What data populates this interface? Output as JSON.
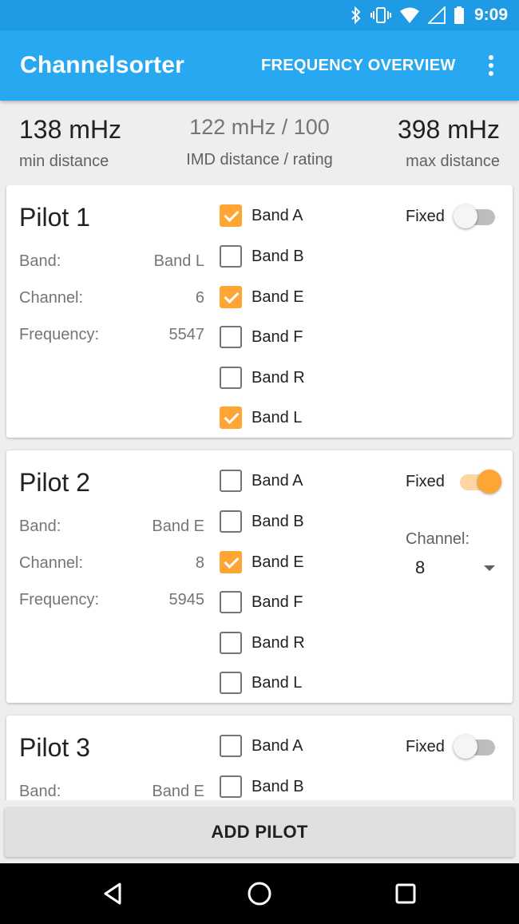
{
  "status_bar": {
    "time": "9:09"
  },
  "app_bar": {
    "title": "Channelsorter",
    "action": "FREQUENCY OVERVIEW"
  },
  "summary": {
    "min": {
      "value": "138 mHz",
      "label": "min distance"
    },
    "imd": {
      "value": "122 mHz / 100",
      "label": "IMD distance / rating"
    },
    "max": {
      "value": "398 mHz",
      "label": "max distance"
    }
  },
  "labels": {
    "band": "Band:",
    "channel": "Channel:",
    "frequency": "Frequency:",
    "fixed": "Fixed",
    "channel_select": "Channel:"
  },
  "pilots": [
    {
      "title": "Pilot 1",
      "band": "Band L",
      "channel": "6",
      "frequency": "5547",
      "fixed": false,
      "bands": [
        {
          "label": "Band A",
          "checked": true
        },
        {
          "label": "Band B",
          "checked": false
        },
        {
          "label": "Band E",
          "checked": true
        },
        {
          "label": "Band F",
          "checked": false
        },
        {
          "label": "Band R",
          "checked": false
        },
        {
          "label": "Band L",
          "checked": true
        }
      ]
    },
    {
      "title": "Pilot 2",
      "band": "Band E",
      "channel": "8",
      "frequency": "5945",
      "fixed": true,
      "selected_channel": "8",
      "bands": [
        {
          "label": "Band A",
          "checked": false
        },
        {
          "label": "Band B",
          "checked": false
        },
        {
          "label": "Band E",
          "checked": true
        },
        {
          "label": "Band F",
          "checked": false
        },
        {
          "label": "Band R",
          "checked": false
        },
        {
          "label": "Band L",
          "checked": false
        }
      ]
    },
    {
      "title": "Pilot 3",
      "band": "Band E",
      "fixed": false,
      "bands": [
        {
          "label": "Band A",
          "checked": false
        },
        {
          "label": "Band B",
          "checked": false
        }
      ]
    }
  ],
  "add_button": "ADD PILOT",
  "colors": {
    "status_bar": "#1e9be4",
    "app_bar": "#27a8f0",
    "accent": "#ffa534"
  },
  "icons": [
    "bluetooth-icon",
    "vibrate-icon",
    "wifi-icon",
    "signal-icon",
    "battery-icon",
    "more-vert-icon",
    "back-icon",
    "home-icon",
    "recents-icon"
  ]
}
